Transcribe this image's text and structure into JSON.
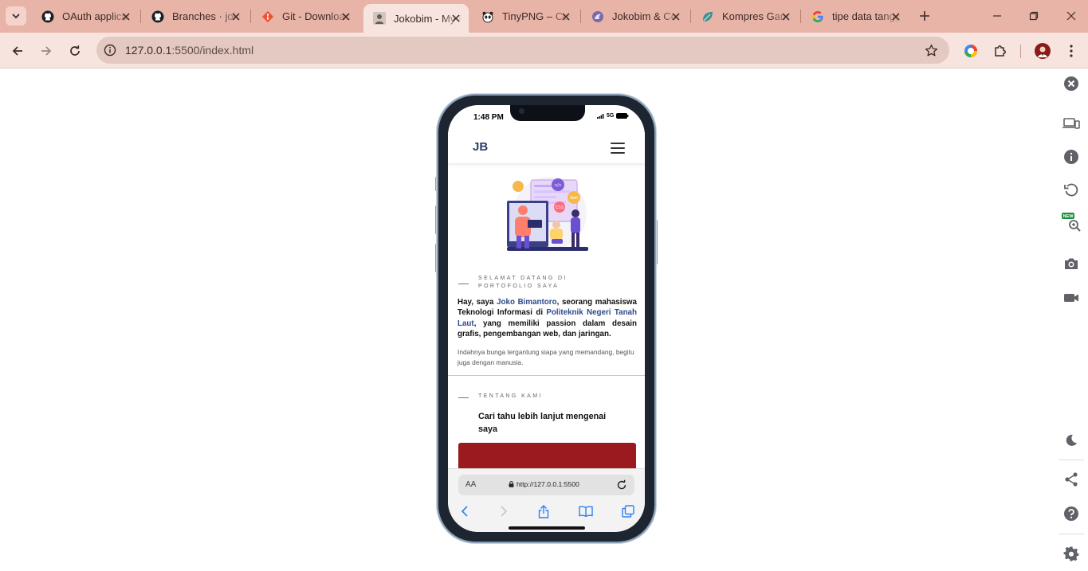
{
  "browser": {
    "tabs": [
      {
        "title": "OAuth applications",
        "icon": "github-icon",
        "active": false
      },
      {
        "title": "Branches · jokobim",
        "icon": "github-icon",
        "active": false
      },
      {
        "title": "Git - Downloads",
        "icon": "git-icon",
        "active": false
      },
      {
        "title": "Jokobim - My Portfolio",
        "icon": "avatar-icon",
        "active": true
      },
      {
        "title": "TinyPNG – Compress",
        "icon": "panda-icon",
        "active": false
      },
      {
        "title": "Jokobim & Co",
        "icon": "dragon-icon",
        "active": false
      },
      {
        "title": "Kompres Gambar",
        "icon": "leaf-icon",
        "active": false
      },
      {
        "title": "tipe data tanggal",
        "icon": "google-icon",
        "active": false
      }
    ],
    "url_host": "127.0.0.1",
    "url_rest": ":5500/index.html"
  },
  "phone": {
    "status": {
      "time": "1:48 PM",
      "network": "5G"
    },
    "site": {
      "logo": "JB",
      "hero_kicker": "SELAMAT DATANG DI PORTOFOLIO SAYA",
      "intro_prefix": "Hay, saya ",
      "intro_name": "Joko Bimantoro",
      "intro_mid": ", seorang mahasiswa Teknologi Informasi di ",
      "intro_school": "Politeknik Negeri Tanah Laut",
      "intro_suffix": ", yang memiliki passion dalam desain grafis, pengembangan web, dan jaringan.",
      "quote": "Indahnya bunga tergantung siapa yang memandang, begitu juga dengan manusia.",
      "about_kicker": "TENTANG KAMI",
      "about_title": "Cari tahu lebih lanjut mengenai saya"
    },
    "safari": {
      "aa_label": "AA",
      "address": "http://127.0.0.1:5500"
    }
  },
  "colors": {
    "tab_strip": "#e8b4a8",
    "toolbar": "#f7e4df",
    "accent_red": "#9b1a1f",
    "brand_blue": "#2c3f6b"
  }
}
